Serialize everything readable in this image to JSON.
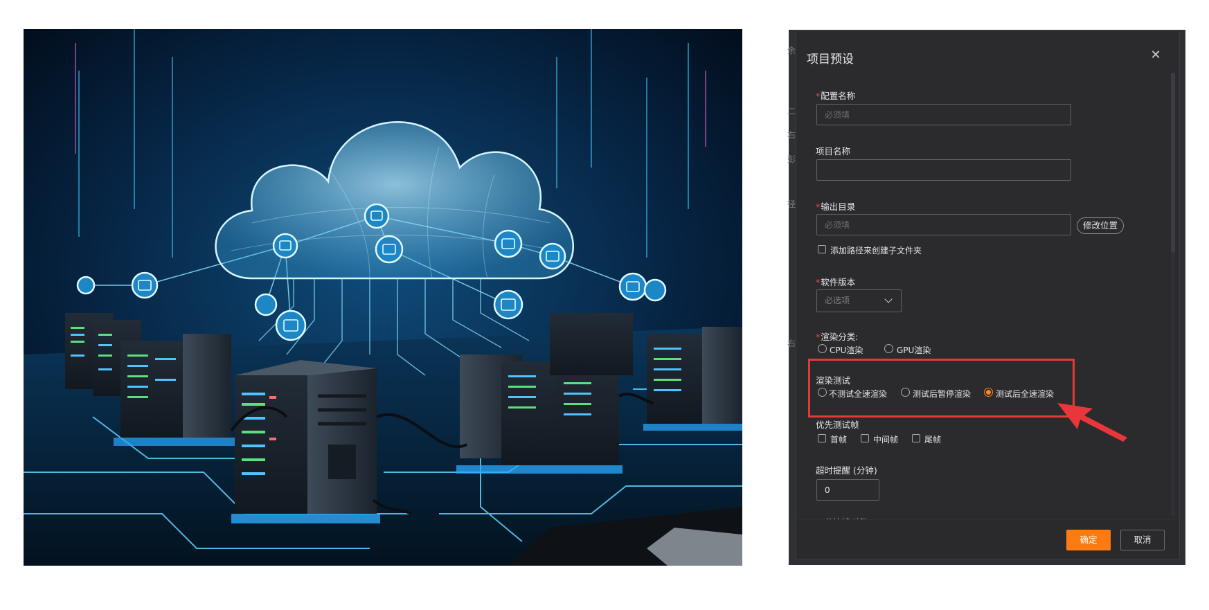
{
  "dialog": {
    "title": "项目预设",
    "close_icon": "close-icon",
    "fields": {
      "config_name": {
        "required": true,
        "label": "配置名称",
        "placeholder": "必须填",
        "value": ""
      },
      "project_name": {
        "required": false,
        "label": "项目名称",
        "placeholder": "",
        "value": ""
      },
      "output_dir": {
        "required": true,
        "label": "输出目录",
        "placeholder": "必须填",
        "value": "",
        "change_button": "修改位置"
      },
      "subfolder_checkbox": {
        "label": "添加路径来创建子文件夹",
        "checked": false
      },
      "software_version": {
        "required": true,
        "label": "软件版本",
        "selected": "必选项"
      },
      "render_type": {
        "required": true,
        "label": "渲染分类:",
        "options": [
          "CPU渲染",
          "GPU渲染"
        ],
        "selected": null
      },
      "render_test": {
        "label": "渲染测试",
        "options": [
          "不测试全速渲染",
          "测试后暂停渲染",
          "测试后全速渲染"
        ],
        "selected": "测试后全速渲染"
      },
      "priority_frames": {
        "label": "优先测试帧",
        "options": [
          "首帧",
          "中间帧",
          "尾帧"
        ]
      },
      "timeout": {
        "label": "超时提醒 (分钟)",
        "value": "0"
      },
      "partial_label": "分块帧 (帧)"
    },
    "footer": {
      "confirm_label": "确定",
      "cancel_label": "取消"
    }
  },
  "edge_glyphs": [
    "余",
    "二",
    "右",
    "彭",
    "径",
    "右"
  ],
  "colors": {
    "accent": "#ff7b12",
    "highlight": "#e43a37",
    "dialog_bg": "#2b2b2e"
  }
}
